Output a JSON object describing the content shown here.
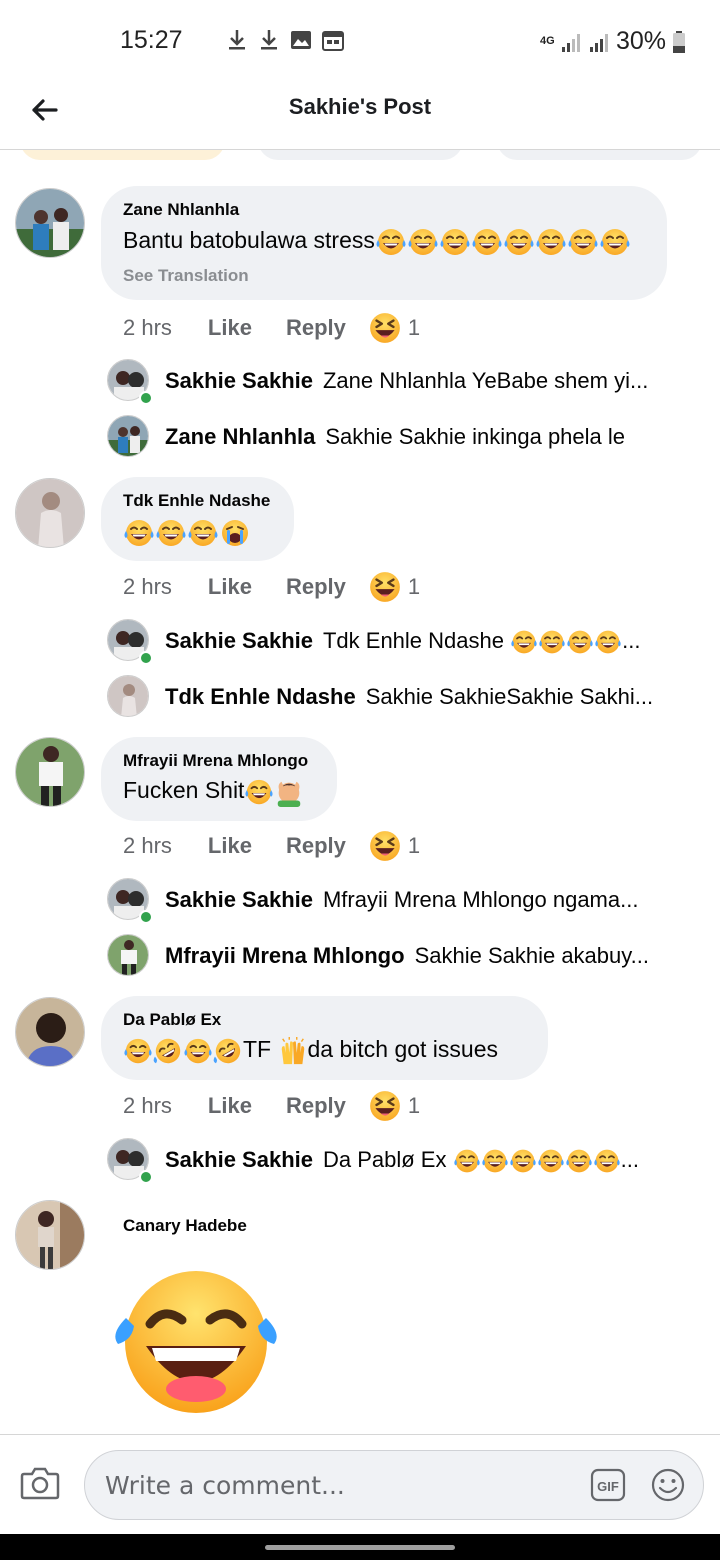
{
  "status_bar": {
    "time": "15:27",
    "battery": "30%",
    "network": "4G"
  },
  "header": {
    "title": "Sakhie's Post"
  },
  "comments": [
    {
      "author": "Zane Nhlanhla",
      "text": "Bantu batobulawa stress",
      "see_translation": "See Translation",
      "time": "2 hrs",
      "like": "Like",
      "reply": "Reply",
      "reaction_count": "1",
      "replies": [
        {
          "name": "Sakhie Sakhie",
          "text": "Zane Nhlanhla YeBabe shem  yi..."
        },
        {
          "name": "Zane Nhlanhla",
          "text": "Sakhie Sakhie inkinga phela le"
        }
      ]
    },
    {
      "author": "Tdk Enhle Ndashe",
      "time": "2 hrs",
      "like": "Like",
      "reply": "Reply",
      "reaction_count": "1",
      "replies": [
        {
          "name": "Sakhie Sakhie",
          "text": "Tdk Enhle Ndashe"
        },
        {
          "name": "Tdk Enhle Ndashe",
          "text": "Sakhie SakhieSakhie Sakhi..."
        }
      ]
    },
    {
      "author": "Mfrayii Mrena Mhlongo",
      "text": "Fucken Shit",
      "time": "2 hrs",
      "like": "Like",
      "reply": "Reply",
      "reaction_count": "1",
      "replies": [
        {
          "name": "Sakhie Sakhie",
          "text": "Mfrayii Mrena Mhlongo ngama..."
        },
        {
          "name": "Mfrayii Mrena Mhlongo",
          "text": "Sakhie Sakhie akabuy..."
        }
      ]
    },
    {
      "author": "Da Pablø Ex",
      "text_tf": "TF",
      "text_rest": "da bitch got issues",
      "time": "2 hrs",
      "like": "Like",
      "reply": "Reply",
      "reaction_count": "1",
      "replies": [
        {
          "name": "Sakhie Sakhie",
          "text": "Da Pablø Ex"
        }
      ]
    },
    {
      "author": "Canary Hadebe"
    }
  ],
  "composer": {
    "placeholder": "Write a comment...",
    "gif_label": "GIF"
  },
  "colors": {
    "bubble": "#eff1f4",
    "meta_text": "#65676b",
    "online": "#31a24c",
    "emoji_yellow": "#ffc83d"
  }
}
